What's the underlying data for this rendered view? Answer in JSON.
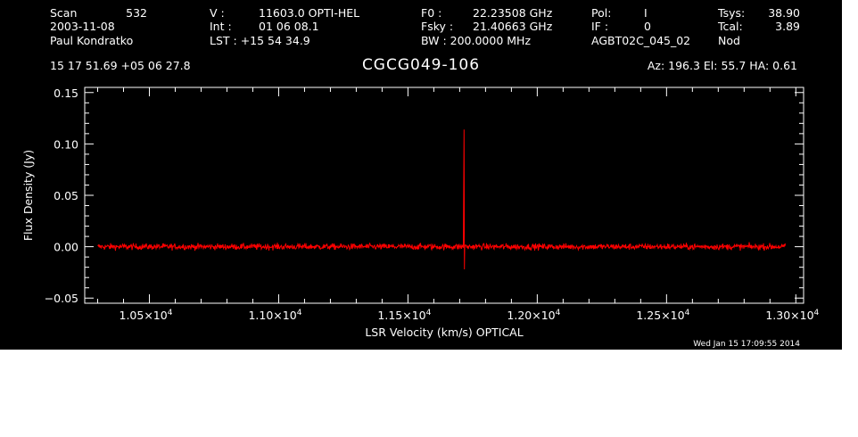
{
  "header": {
    "rows": [
      [
        "Scan",
        "532",
        "V   :",
        "11603.0 OPTI-HEL",
        "F0   :",
        "22.23508 GHz",
        "Pol:",
        "I",
        "Tsys:",
        "38.90"
      ],
      [
        "2003-11-08",
        "",
        "Int  :",
        "01 06 08.1",
        "Fsky :",
        "21.40663 GHz",
        "IF :",
        "0",
        "Tcal:",
        "3.89"
      ],
      [
        "Paul Kondratko",
        "",
        "LST : +15 54 34.9",
        "",
        "BW   : 200.0000 MHz",
        "",
        "AGBT02C_045_02",
        "",
        "Nod",
        ""
      ]
    ],
    "coords": "15 17 51.69  +05 06 27.8",
    "source": "CGCG049-106",
    "azelha": "Az: 196.3   El:  55.7   HA:  0.61"
  },
  "footer": {
    "timestamp": "Wed Jan 15 17:09:55 2014"
  },
  "colors": {
    "background": "#000000",
    "axes": "#ffffff",
    "series": "#ff0000"
  },
  "chart_data": {
    "type": "line",
    "title": "CGCG049-106",
    "xlabel": "LSR Velocity (km/s) OPTICAL",
    "ylabel": "Flux Density (Jy)",
    "xlim": [
      10250,
      13030
    ],
    "ylim": [
      -0.055,
      0.155
    ],
    "x_ticks": [
      10500,
      11000,
      11500,
      12000,
      12500,
      13000
    ],
    "x_tick_labels": [
      "1.05×10",
      "1.10×10",
      "1.15×10",
      "1.20×10",
      "1.25×10",
      "1.30×10"
    ],
    "x_tick_exponent": "4",
    "y_ticks": [
      -0.05,
      0.0,
      0.05,
      0.1,
      0.15
    ],
    "y_tick_labels": [
      "−0.05",
      "0.00",
      "0.05",
      "0.10",
      "0.15"
    ],
    "series": [
      {
        "x_range": [
          10300,
          12960
        ],
        "baseline": 0.0,
        "noise_rms": 0.0015,
        "spike": {
          "x": 11717,
          "peak": 0.114,
          "trough": -0.022
        }
      }
    ]
  }
}
